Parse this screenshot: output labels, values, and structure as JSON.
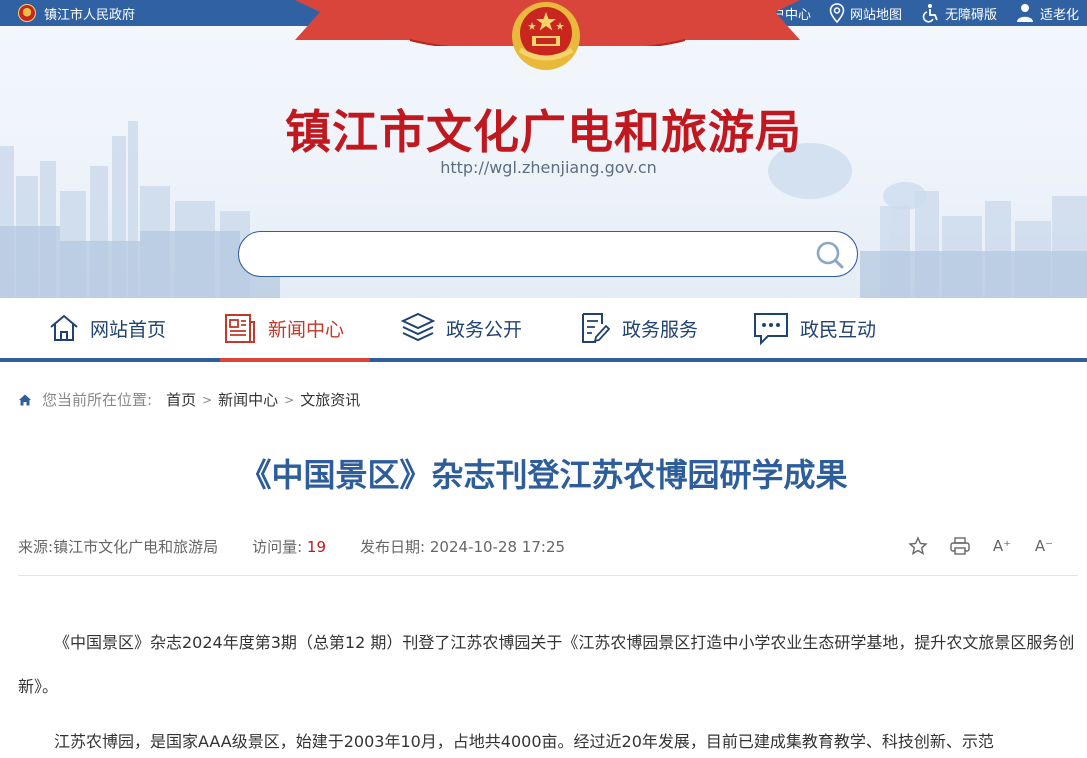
{
  "topbar": {
    "gov_name": "镇江市人民政府",
    "links": [
      {
        "label": "用户中心",
        "icon": "user-icon"
      },
      {
        "label": "网站地图",
        "icon": "location-icon"
      },
      {
        "label": "无障碍版",
        "icon": "accessibility-icon"
      },
      {
        "label": "适老化",
        "icon": "elderly-icon"
      }
    ]
  },
  "banner": {
    "title": "镇江市文化广电和旅游局",
    "url": "http://wgl.zhenjiang.gov.cn",
    "search_placeholder": ""
  },
  "nav": {
    "items": [
      {
        "label": "网站首页",
        "icon": "home-icon"
      },
      {
        "label": "新闻中心",
        "icon": "newspaper-icon"
      },
      {
        "label": "政务公开",
        "icon": "layers-icon"
      },
      {
        "label": "政务服务",
        "icon": "document-edit-icon"
      },
      {
        "label": "政民互动",
        "icon": "chat-icon"
      }
    ],
    "active": "新闻中心"
  },
  "breadcrumb": {
    "prefix": "您当前所在位置:",
    "items": [
      "首页",
      "新闻中心",
      "文旅资讯"
    ],
    "separator": ">"
  },
  "article": {
    "title": "《中国景区》杂志刊登江苏农博园研学成果",
    "source_label": "来源:",
    "source": "镇江市文化广电和旅游局",
    "views_label": "访问量:",
    "views": "19",
    "date_label": "发布日期:",
    "date": "2024-10-28 17:25",
    "tools": [
      "favorite-icon",
      "print-icon",
      "font-increase-icon",
      "font-decrease-icon"
    ],
    "font_increase": "A⁺",
    "font_decrease": "A⁻",
    "paragraphs": [
      "《中国景区》杂志2024年度第3期（总第12 期）刊登了江苏农博园关于《江苏农博园景区打造中小学农业生态研学基地，提升农文旅景区服务创新》。",
      "江苏农博园，是国家AAA级景区，始建于2003年10月，占地共4000亩。经过近20年发展，目前已建成集教育教学、科技创新、示范"
    ]
  },
  "colors": {
    "topbar": "#2f61a3",
    "title_red": "#c0181e",
    "nav_blue": "#1f4272",
    "active_red": "#d9453b",
    "article_title": "#2d5d9b"
  }
}
